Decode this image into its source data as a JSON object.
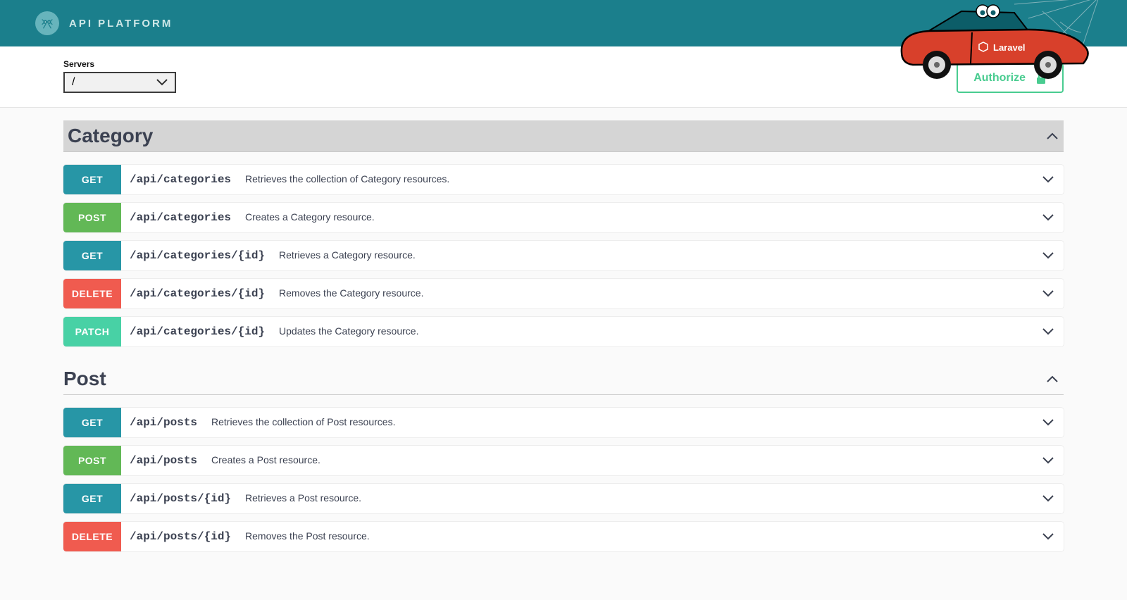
{
  "header": {
    "product_name": "API PLATFORM",
    "car_badge_text": "Laravel"
  },
  "controls": {
    "servers_label": "Servers",
    "servers_selected": "/",
    "authorize_label": "Authorize"
  },
  "groups": [
    {
      "name": "Category",
      "highlighted": true,
      "ops": [
        {
          "method": "GET",
          "path": "/api/categories",
          "desc": "Retrieves the collection of Category resources."
        },
        {
          "method": "POST",
          "path": "/api/categories",
          "desc": "Creates a Category resource."
        },
        {
          "method": "GET",
          "path": "/api/categories/{id}",
          "desc": "Retrieves a Category resource."
        },
        {
          "method": "DELETE",
          "path": "/api/categories/{id}",
          "desc": "Removes the Category resource."
        },
        {
          "method": "PATCH",
          "path": "/api/categories/{id}",
          "desc": "Updates the Category resource."
        }
      ]
    },
    {
      "name": "Post",
      "highlighted": false,
      "ops": [
        {
          "method": "GET",
          "path": "/api/posts",
          "desc": "Retrieves the collection of Post resources."
        },
        {
          "method": "POST",
          "path": "/api/posts",
          "desc": "Creates a Post resource."
        },
        {
          "method": "GET",
          "path": "/api/posts/{id}",
          "desc": "Retrieves a Post resource."
        },
        {
          "method": "DELETE",
          "path": "/api/posts/{id}",
          "desc": "Removes the Post resource."
        }
      ]
    }
  ],
  "colors": {
    "brand": "#1b7f8c",
    "get": "#2796a6",
    "post": "#62b856",
    "delete": "#f05b4f",
    "patch": "#48d1a5",
    "authorize": "#49cc90"
  }
}
